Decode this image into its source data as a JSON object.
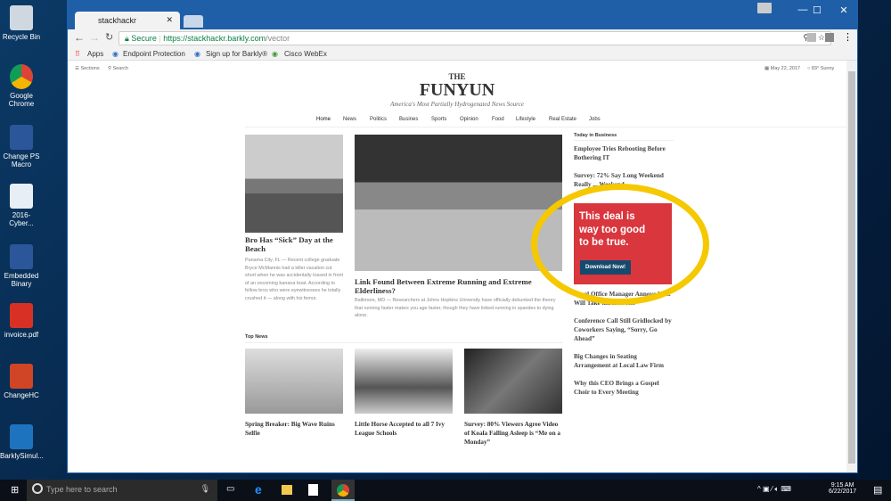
{
  "desktop": {
    "icons": [
      "Recycle Bin",
      "Google Chrome",
      "Change PS Macro",
      "2016-Cyber...",
      "Embedded Binary",
      "invoice.pdf",
      "ChangeHC",
      "BarklySimul..."
    ]
  },
  "browser": {
    "tab_title": "stackhackr",
    "secure_label": "Secure",
    "url_host": "https://stackhackr.barkly.com",
    "url_path": "/vector",
    "bookmarks": [
      "Apps",
      "Endpoint Protection",
      "Sign up for Barkly®",
      "Cisco WebEx"
    ]
  },
  "site": {
    "sections": "Sections",
    "search": "Search",
    "date": "May 22, 2017",
    "weather": "83° Sunny",
    "masthead_the": "THE",
    "masthead_name": "FUNYUN",
    "tagline": "America's Most Partially Hydrogenated News Source",
    "nav": [
      "Home",
      "News",
      "Politics",
      "Busines",
      "Sports",
      "Opinion",
      "Food",
      "Lifestyle",
      "Real Estate",
      "Jobs"
    ],
    "story1": {
      "title": "Bro Has “Sick” Day at the Beach",
      "body": "Panama City, FL — Recent college graduate Bryce McMannis had a killer vacation cut short when he was accidentally tossed in front of an oncoming banana boat. According to fellow bros who were eyewitnesses he totally crushed it — along with his femur."
    },
    "story2": {
      "title": "Link Found Between Extreme Running and Extreme Elderliness?",
      "body": "Baltimore, MD — Researchers at Johns Hopkins University have officially debunked the theory that running faster makes you age faster, though they have linked running in spandex to dying alone."
    },
    "top_news_label": "Top News",
    "top_news": [
      "Spring Breaker: Big Wave Ruins Selfie",
      "Little Horse Accepted to all 7 Ivy League Schools",
      "Survey: 80% Viewers Agree Video of Koala Falling Asleep is “Me on a Monday”"
    ],
    "sidebar_label": "Today in Business",
    "sidebar": [
      "Employee Tries Rebooting Before Bothering IT",
      "Survey: 72% Say Long Weekend Really ... Weekend",
      "Local Office Manager Annoyed N... Will Take the Last R...",
      "Conference Call Still Gridlocked by Coworkers Saying, “Sorry, Go Ahead”",
      "Big Changes in Seating Arrangement at Local Law Firm",
      "Why this CEO Brings a Gospel Choir to Every Meeting"
    ],
    "ad": {
      "headline": "This deal is way too good to be true.",
      "button": "Download Now!",
      "color": "#d9363e"
    }
  },
  "taskbar": {
    "search_placeholder": "Type here to search",
    "time": "9:15 AM",
    "date": "6/22/2017"
  },
  "colors": {
    "highlight_ellipse": "#f5c800",
    "chrome_blue": "#1f5fa8"
  }
}
